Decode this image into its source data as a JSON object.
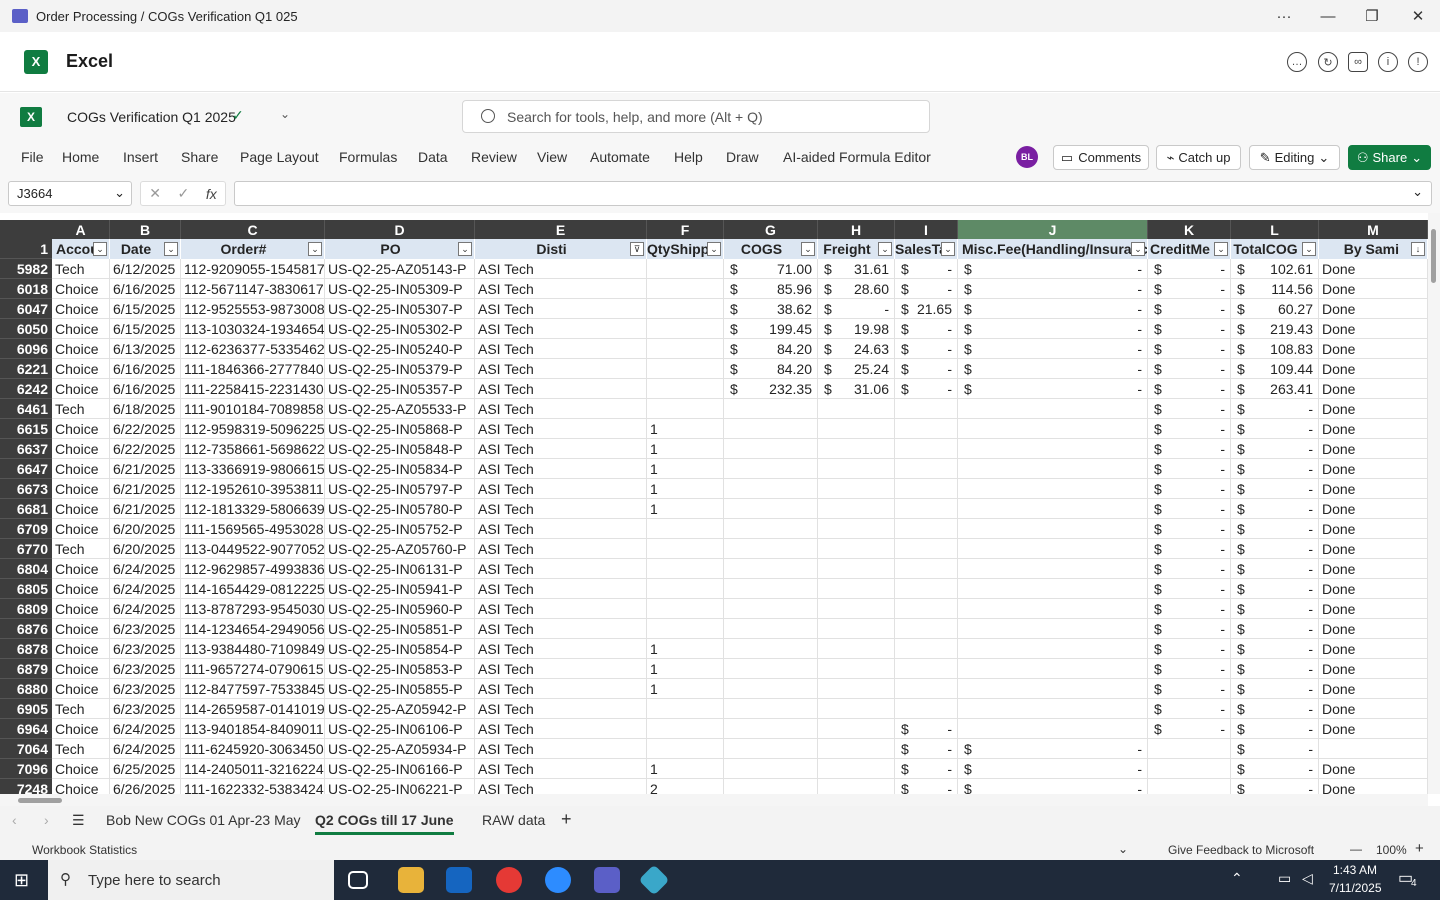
{
  "window": {
    "title": "Order Processing / COGs Verification Q1 025",
    "more": "···",
    "minimize": "—",
    "restore": "❐",
    "close": "✕"
  },
  "app": {
    "name": "Excel",
    "logo_letter": "X"
  },
  "doc": {
    "name": "COGs Verification Q1 2025",
    "search_placeholder": "Search for tools, help, and more (Alt + Q)"
  },
  "ribbon": {
    "tabs": [
      "File",
      "Home",
      "Insert",
      "Share",
      "Page Layout",
      "Formulas",
      "Data",
      "Review",
      "View",
      "Automate",
      "Help",
      "Draw",
      "AI-aided Formula Editor"
    ],
    "avatar": "BL",
    "comments": "Comments",
    "catchup": "Catch up",
    "editing": "Editing",
    "share": "Share"
  },
  "formula": {
    "namebox": "J3664",
    "fx": "fx",
    "cancel": "✕",
    "enter": "✓",
    "value": ""
  },
  "columns": [
    {
      "letter": "A",
      "header": "Accou"
    },
    {
      "letter": "B",
      "header": "Date"
    },
    {
      "letter": "C",
      "header": "Order#"
    },
    {
      "letter": "D",
      "header": "PO"
    },
    {
      "letter": "E",
      "header": "Disti"
    },
    {
      "letter": "F",
      "header": "QtyShipp"
    },
    {
      "letter": "G",
      "header": "COGS"
    },
    {
      "letter": "H",
      "header": "Freight"
    },
    {
      "letter": "I",
      "header": "SalesTa"
    },
    {
      "letter": "J",
      "header": "Misc.Fee(Handling/Insuranc"
    },
    {
      "letter": "K",
      "header": "CreditMe"
    },
    {
      "letter": "L",
      "header": "TotalCOG"
    },
    {
      "letter": "M",
      "header": "By Sami"
    }
  ],
  "header_row_num": "1",
  "rows": [
    {
      "n": "5982",
      "a": "Tech",
      "b": "6/12/2025",
      "c": "112-9209055-1545817",
      "d": "US-Q2-25-AZ05143-P",
      "e": "ASI Tech",
      "f": "",
      "g": "71.00",
      "h": "31.61",
      "i": "-",
      "j": "-",
      "k": "-",
      "l": "102.61",
      "m": "Done"
    },
    {
      "n": "6018",
      "a": "Choice",
      "b": "6/16/2025",
      "c": "112-5671147-3830617",
      "d": "US-Q2-25-IN05309-P",
      "e": "ASI Tech",
      "f": "",
      "g": "85.96",
      "h": "28.60",
      "i": "-",
      "j": "-",
      "k": "-",
      "l": "114.56",
      "m": "Done"
    },
    {
      "n": "6047",
      "a": "Choice",
      "b": "6/15/2025",
      "c": "112-9525553-9873008",
      "d": "US-Q2-25-IN05307-P",
      "e": "ASI Tech",
      "f": "",
      "g": "38.62",
      "h": "-",
      "i": "21.65",
      "j": "-",
      "k": "-",
      "l": "60.27",
      "m": "Done"
    },
    {
      "n": "6050",
      "a": "Choice",
      "b": "6/15/2025",
      "c": "113-1030324-1934654",
      "d": "US-Q2-25-IN05302-P",
      "e": "ASI Tech",
      "f": "",
      "g": "199.45",
      "h": "19.98",
      "i": "-",
      "j": "-",
      "k": "-",
      "l": "219.43",
      "m": "Done"
    },
    {
      "n": "6096",
      "a": "Choice",
      "b": "6/13/2025",
      "c": "112-6236377-5335462",
      "d": "US-Q2-25-IN05240-P",
      "e": "ASI Tech",
      "f": "",
      "g": "84.20",
      "h": "24.63",
      "i": "-",
      "j": "-",
      "k": "-",
      "l": "108.83",
      "m": "Done"
    },
    {
      "n": "6221",
      "a": "Choice",
      "b": "6/16/2025",
      "c": "111-1846366-2777840",
      "d": "US-Q2-25-IN05379-P",
      "e": "ASI Tech",
      "f": "",
      "g": "84.20",
      "h": "25.24",
      "i": "-",
      "j": "-",
      "k": "-",
      "l": "109.44",
      "m": "Done"
    },
    {
      "n": "6242",
      "a": "Choice",
      "b": "6/16/2025",
      "c": "111-2258415-2231430",
      "d": "US-Q2-25-IN05357-P",
      "e": "ASI Tech",
      "f": "",
      "g": "232.35",
      "h": "31.06",
      "i": "-",
      "j": "-",
      "k": "-",
      "l": "263.41",
      "m": "Done"
    },
    {
      "n": "6461",
      "a": "Tech",
      "b": "6/18/2025",
      "c": "111-9010184-7089858",
      "d": "US-Q2-25-AZ05533-P",
      "e": "ASI Tech",
      "f": "",
      "g": "",
      "h": "",
      "i": "",
      "j": "",
      "k": "-",
      "l": "-",
      "m": "Done"
    },
    {
      "n": "6615",
      "a": "Choice",
      "b": "6/22/2025",
      "c": "112-9598319-5096225",
      "d": "US-Q2-25-IN05868-P",
      "e": "ASI Tech",
      "f": "1",
      "g": "",
      "h": "",
      "i": "",
      "j": "",
      "k": "-",
      "l": "-",
      "m": "Done"
    },
    {
      "n": "6637",
      "a": "Choice",
      "b": "6/22/2025",
      "c": "112-7358661-5698622",
      "d": "US-Q2-25-IN05848-P",
      "e": "ASI Tech",
      "f": "1",
      "g": "",
      "h": "",
      "i": "",
      "j": "",
      "k": "-",
      "l": "-",
      "m": "Done"
    },
    {
      "n": "6647",
      "a": "Choice",
      "b": "6/21/2025",
      "c": "113-3366919-9806615",
      "d": "US-Q2-25-IN05834-P",
      "e": "ASI Tech",
      "f": "1",
      "g": "",
      "h": "",
      "i": "",
      "j": "",
      "k": "-",
      "l": "-",
      "m": "Done"
    },
    {
      "n": "6673",
      "a": "Choice",
      "b": "6/21/2025",
      "c": "112-1952610-3953811",
      "d": "US-Q2-25-IN05797-P",
      "e": "ASI Tech",
      "f": "1",
      "g": "",
      "h": "",
      "i": "",
      "j": "",
      "k": "-",
      "l": "-",
      "m": "Done"
    },
    {
      "n": "6681",
      "a": "Choice",
      "b": "6/21/2025",
      "c": "112-1813329-5806639",
      "d": "US-Q2-25-IN05780-P",
      "e": "ASI Tech",
      "f": "1",
      "g": "",
      "h": "",
      "i": "",
      "j": "",
      "k": "-",
      "l": "-",
      "m": "Done"
    },
    {
      "n": "6709",
      "a": "Choice",
      "b": "6/20/2025",
      "c": "111-1569565-4953028",
      "d": "US-Q2-25-IN05752-P",
      "e": "ASI Tech",
      "f": "",
      "g": "",
      "h": "",
      "i": "",
      "j": "",
      "k": "-",
      "l": "-",
      "m": "Done"
    },
    {
      "n": "6770",
      "a": "Tech",
      "b": "6/20/2025",
      "c": "113-0449522-9077052",
      "d": "US-Q2-25-AZ05760-P",
      "e": "ASI Tech",
      "f": "",
      "g": "",
      "h": "",
      "i": "",
      "j": "",
      "k": "-",
      "l": "-",
      "m": "Done"
    },
    {
      "n": "6804",
      "a": "Choice",
      "b": "6/24/2025",
      "c": "112-9629857-4993836",
      "d": "US-Q2-25-IN06131-P",
      "e": "ASI Tech",
      "f": "",
      "g": "",
      "h": "",
      "i": "",
      "j": "",
      "k": "-",
      "l": "-",
      "m": "Done"
    },
    {
      "n": "6805",
      "a": "Choice",
      "b": "6/24/2025",
      "c": "114-1654429-0812225",
      "d": "US-Q2-25-IN05941-P",
      "e": "ASI Tech",
      "f": "",
      "g": "",
      "h": "",
      "i": "",
      "j": "",
      "k": "-",
      "l": "-",
      "m": "Done"
    },
    {
      "n": "6809",
      "a": "Choice",
      "b": "6/24/2025",
      "c": "113-8787293-9545030",
      "d": "US-Q2-25-IN05960-P",
      "e": "ASI Tech",
      "f": "",
      "g": "",
      "h": "",
      "i": "",
      "j": "",
      "k": "-",
      "l": "-",
      "m": "Done"
    },
    {
      "n": "6876",
      "a": "Choice",
      "b": "6/23/2025",
      "c": "114-1234654-2949056",
      "d": "US-Q2-25-IN05851-P",
      "e": "ASI Tech",
      "f": "",
      "g": "",
      "h": "",
      "i": "",
      "j": "",
      "k": "-",
      "l": "-",
      "m": "Done"
    },
    {
      "n": "6878",
      "a": "Choice",
      "b": "6/23/2025",
      "c": "113-9384480-7109849",
      "d": "US-Q2-25-IN05854-P",
      "e": "ASI Tech",
      "f": "1",
      "g": "",
      "h": "",
      "i": "",
      "j": "",
      "k": "-",
      "l": "-",
      "m": "Done"
    },
    {
      "n": "6879",
      "a": "Choice",
      "b": "6/23/2025",
      "c": "111-9657274-0790615",
      "d": "US-Q2-25-IN05853-P",
      "e": "ASI Tech",
      "f": "1",
      "g": "",
      "h": "",
      "i": "",
      "j": "",
      "k": "-",
      "l": "-",
      "m": "Done"
    },
    {
      "n": "6880",
      "a": "Choice",
      "b": "6/23/2025",
      "c": "112-8477597-7533845",
      "d": "US-Q2-25-IN05855-P",
      "e": "ASI Tech",
      "f": "1",
      "g": "",
      "h": "",
      "i": "",
      "j": "",
      "k": "-",
      "l": "-",
      "m": "Done"
    },
    {
      "n": "6905",
      "a": "Tech",
      "b": "6/23/2025",
      "c": "114-2659587-0141019",
      "d": "US-Q2-25-AZ05942-P",
      "e": "ASI Tech",
      "f": "",
      "g": "",
      "h": "",
      "i": "",
      "j": "",
      "k": "-",
      "l": "-",
      "m": "Done"
    },
    {
      "n": "6964",
      "a": "Choice",
      "b": "6/24/2025",
      "c": "113-9401854-8409011",
      "d": "US-Q2-25-IN06106-P",
      "e": "ASI Tech",
      "f": "",
      "g": "",
      "h": "",
      "i": "-",
      "j": "",
      "k": "-",
      "l": "-",
      "m": "Done"
    },
    {
      "n": "7064",
      "a": "Tech",
      "b": "6/24/2025",
      "c": "111-6245920-3063450",
      "d": "US-Q2-25-AZ05934-P",
      "e": "ASI Tech",
      "f": "",
      "g": "",
      "h": "",
      "i": "-",
      "j": "-",
      "k": "",
      "l": "-",
      "m": ""
    },
    {
      "n": "7096",
      "a": "Choice",
      "b": "6/25/2025",
      "c": "114-2405011-3216224",
      "d": "US-Q2-25-IN06166-P",
      "e": "ASI Tech",
      "f": "1",
      "g": "",
      "h": "",
      "i": "-",
      "j": "-",
      "k": "",
      "l": "-",
      "m": "Done"
    },
    {
      "n": "7248",
      "a": "Choice",
      "b": "6/26/2025",
      "c": "111-1622332-5383424",
      "d": "US-Q2-25-IN06221-P",
      "e": "ASI Tech",
      "f": "2",
      "g": "",
      "h": "",
      "i": "-",
      "j": "-",
      "k": "",
      "l": "-",
      "m": "Done"
    }
  ],
  "currency_symbol": "$",
  "sheets": {
    "tabs": [
      "Bob New COGs 01 Apr-23 May",
      "Q2 COGs till 17 June",
      "RAW data"
    ],
    "active": 1,
    "add": "+",
    "menu": "☰"
  },
  "status": {
    "left": "Workbook Statistics",
    "feedback": "Give Feedback to Microsoft",
    "zoom": "100%",
    "minus": "—",
    "plus": "+"
  },
  "taskbar": {
    "search_placeholder": "Type here to search",
    "time": "1:43 AM",
    "date": "7/11/2025",
    "notif": "4"
  },
  "colors": {
    "excel_green": "#107c41",
    "header_dark": "#3d3d3d",
    "header_selected": "#5e8a66",
    "table_header": "#dce6f2",
    "taskbar": "#1f2a3a"
  }
}
